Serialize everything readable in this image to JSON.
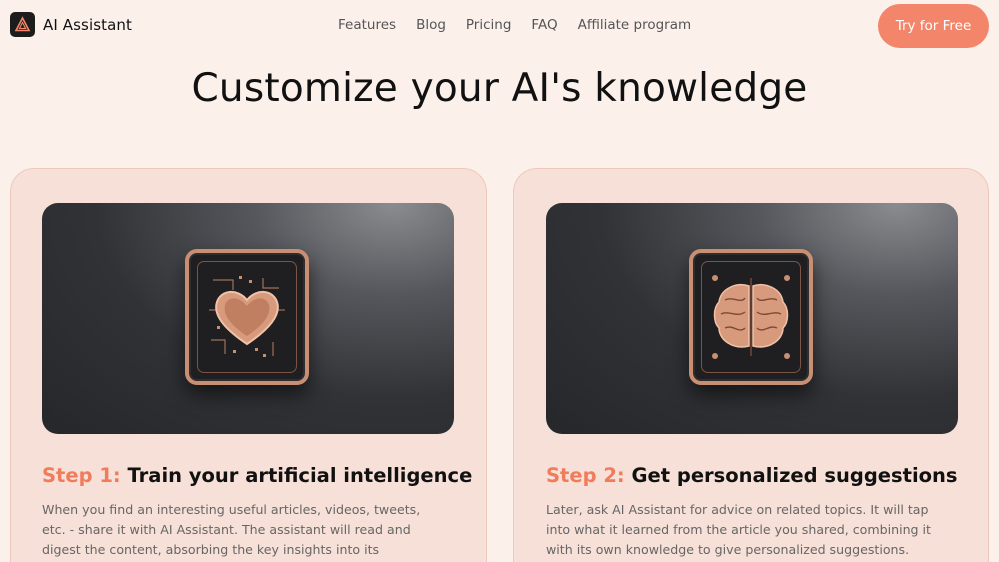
{
  "header": {
    "brand": "AI Assistant",
    "logo_icon": "triangle-logo-icon",
    "nav": [
      "Features",
      "Blog",
      "Pricing",
      "FAQ",
      "Affiliate program"
    ],
    "cta_label": "Try for Free"
  },
  "hero": {
    "title": "Customize your AI's knowledge"
  },
  "steps": [
    {
      "label": "Step 1:",
      "title": "Train your artificial intelligence",
      "text": "When you find an interesting useful articles, videos, tweets, etc. - share it with AI Assistant. The assistant will read and digest the content, absorbing the key insights into its knowledge base.",
      "image_icon": "heart-chip-icon"
    },
    {
      "label": "Step 2:",
      "title": "Get personalized suggestions",
      "text": "Later, ask AI Assistant for advice on related topics. It will tap into what it learned from the article you shared, combining it with its own knowledge to give personalized suggestions.",
      "image_icon": "brain-chip-icon"
    }
  ],
  "colors": {
    "background": "#fcf0eb",
    "card": "#f6e0d8",
    "accent": "#f3866a",
    "step_label": "#f07c5b"
  }
}
